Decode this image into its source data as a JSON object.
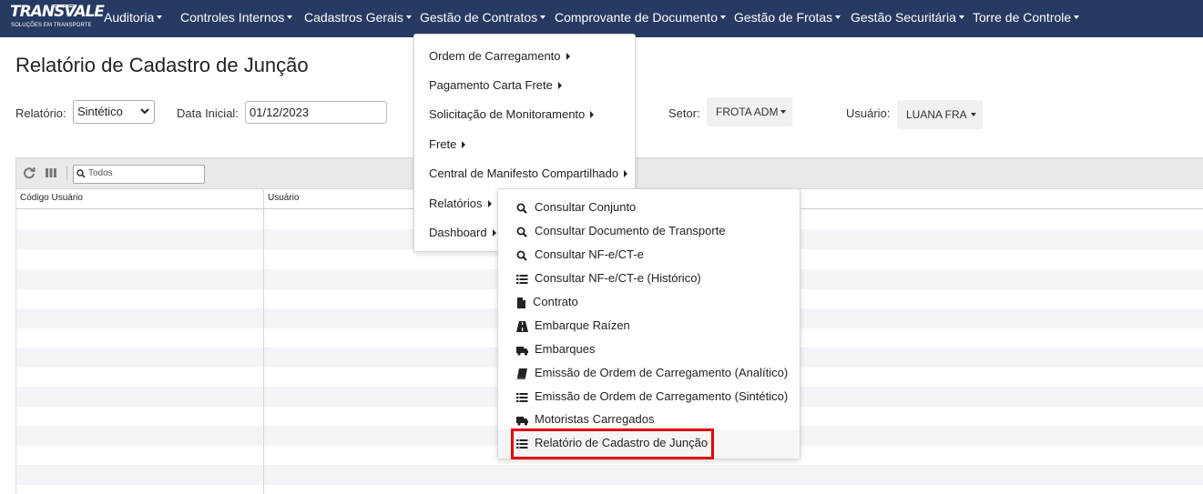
{
  "nav": {
    "logo_text": "TRANSVALE",
    "logo_subtitle": "SOLUÇÕES EM TRANSPORTE",
    "items": [
      {
        "label": "Auditoria"
      },
      {
        "label": "Controles Internos"
      },
      {
        "label": "Cadastros Gerais"
      },
      {
        "label": "Gestão de Contratos"
      },
      {
        "label": "Comprovante de Documento"
      },
      {
        "label": "Gestão de Frotas"
      },
      {
        "label": "Gestão Securitária"
      },
      {
        "label": "Torre de Controle"
      }
    ]
  },
  "page": {
    "title": "Relatório de Cadastro de Junção"
  },
  "filters": {
    "relatorio_label": "Relatório:",
    "relatorio_value": "Sintético",
    "data_inicial_label": "Data Inicial:",
    "data_inicial_value": "01/12/2023",
    "setor_label": "Setor:",
    "setor_value": "FROTA ADM",
    "usuario_label": "Usuário:",
    "usuario_value": "LUANA FRA"
  },
  "table": {
    "search_placeholder": "Todos",
    "columns": [
      "Código Usuário",
      "Usuário"
    ]
  },
  "menu": {
    "items": [
      {
        "label": "Ordem de Carregamento"
      },
      {
        "label": "Pagamento Carta Frete"
      },
      {
        "label": "Solicitação de Monitoramento"
      },
      {
        "label": "Frete"
      },
      {
        "label": "Central de Manifesto Compartilhado"
      },
      {
        "label": "Relatórios"
      },
      {
        "label": "Dashboard"
      }
    ]
  },
  "submenu": {
    "items": [
      {
        "label": "Consultar Conjunto",
        "icon": "search-icon"
      },
      {
        "label": "Consultar Documento de Transporte",
        "icon": "search-icon"
      },
      {
        "label": "Consultar NF-e/CT-e",
        "icon": "search-icon"
      },
      {
        "label": "Consultar NF-e/CT-e (Histórico)",
        "icon": "list-icon"
      },
      {
        "label": "Contrato",
        "icon": "file-icon"
      },
      {
        "label": "Embarque Raízen",
        "icon": "road-icon"
      },
      {
        "label": "Embarques",
        "icon": "truck-icon"
      },
      {
        "label": "Emissão de Ordem de Carregamento (Analítico)",
        "icon": "book-icon"
      },
      {
        "label": "Emissão de Ordem de Carregamento (Sintético)",
        "icon": "list-icon"
      },
      {
        "label": "Motoristas Carregados",
        "icon": "truck-icon"
      },
      {
        "label": "Relatório de Cadastro de Junção",
        "icon": "list-icon"
      }
    ]
  },
  "colors": {
    "navbar": "#263a63",
    "highlight_border": "#e00000"
  }
}
